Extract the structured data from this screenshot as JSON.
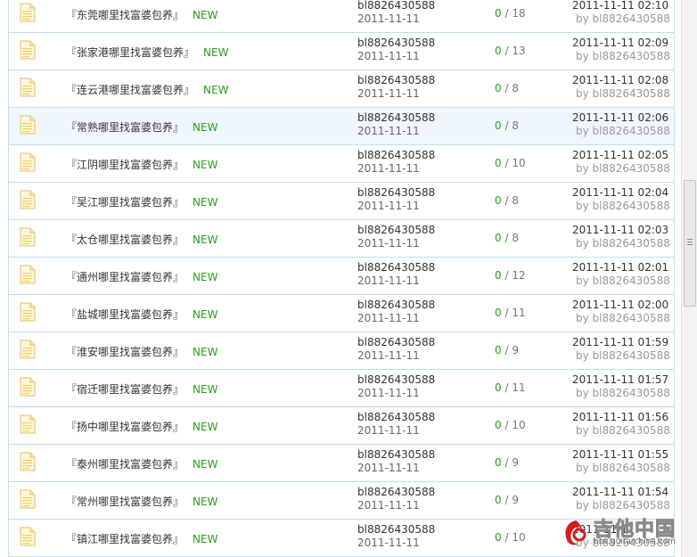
{
  "threads": [
    {
      "title": "『东莞哪里找富婆包养』",
      "badge": "NEW",
      "author": "bl8826430588",
      "post_date": "2011-11-11",
      "replies": "0",
      "views": "18",
      "last_time": "2011-11-11 02:10",
      "last_by": "by bl8826430588"
    },
    {
      "title": "『张家港哪里找富婆包养』",
      "badge": "NEW",
      "author": "bl8826430588",
      "post_date": "2011-11-11",
      "replies": "0",
      "views": "13",
      "last_time": "2011-11-11 02:09",
      "last_by": "by bl8826430588"
    },
    {
      "title": "『连云港哪里找富婆包养』",
      "badge": "NEW",
      "author": "bl8826430588",
      "post_date": "2011-11-11",
      "replies": "0",
      "views": "8",
      "last_time": "2011-11-11 02:08",
      "last_by": "by bl8826430588"
    },
    {
      "title": "『常熟哪里找富婆包养』",
      "badge": "NEW",
      "author": "bl8826430588",
      "post_date": "2011-11-11",
      "replies": "0",
      "views": "8",
      "last_time": "2011-11-11 02:06",
      "last_by": "by bl8826430588"
    },
    {
      "title": "『江阴哪里找富婆包养』",
      "badge": "NEW",
      "author": "bl8826430588",
      "post_date": "2011-11-11",
      "replies": "0",
      "views": "10",
      "last_time": "2011-11-11 02:05",
      "last_by": "by bl8826430588"
    },
    {
      "title": "『吴江哪里找富婆包养』",
      "badge": "NEW",
      "author": "bl8826430588",
      "post_date": "2011-11-11",
      "replies": "0",
      "views": "8",
      "last_time": "2011-11-11 02:04",
      "last_by": "by bl8826430588"
    },
    {
      "title": "『太仓哪里找富婆包养』",
      "badge": "NEW",
      "author": "bl8826430588",
      "post_date": "2011-11-11",
      "replies": "0",
      "views": "8",
      "last_time": "2011-11-11 02:03",
      "last_by": "by bl8826430588"
    },
    {
      "title": "『通州哪里找富婆包养』",
      "badge": "NEW",
      "author": "bl8826430588",
      "post_date": "2011-11-11",
      "replies": "0",
      "views": "12",
      "last_time": "2011-11-11 02:01",
      "last_by": "by bl8826430588"
    },
    {
      "title": "『盐城哪里找富婆包养』",
      "badge": "NEW",
      "author": "bl8826430588",
      "post_date": "2011-11-11",
      "replies": "0",
      "views": "11",
      "last_time": "2011-11-11 02:00",
      "last_by": "by bl8826430588"
    },
    {
      "title": "『淮安哪里找富婆包养』",
      "badge": "NEW",
      "author": "bl8826430588",
      "post_date": "2011-11-11",
      "replies": "0",
      "views": "9",
      "last_time": "2011-11-11 01:59",
      "last_by": "by bl8826430588"
    },
    {
      "title": "『宿迁哪里找富婆包养』",
      "badge": "NEW",
      "author": "bl8826430588",
      "post_date": "2011-11-11",
      "replies": "0",
      "views": "11",
      "last_time": "2011-11-11 01:57",
      "last_by": "by bl8826430588"
    },
    {
      "title": "『扬中哪里找富婆包养』",
      "badge": "NEW",
      "author": "bl8826430588",
      "post_date": "2011-11-11",
      "replies": "0",
      "views": "10",
      "last_time": "2011-11-11 01:56",
      "last_by": "by bl8826430588"
    },
    {
      "title": "『泰州哪里找富婆包养』",
      "badge": "NEW",
      "author": "bl8826430588",
      "post_date": "2011-11-11",
      "replies": "0",
      "views": "9",
      "last_time": "2011-11-11 01:55",
      "last_by": "by bl8826430588"
    },
    {
      "title": "『常州哪里找富婆包养』",
      "badge": "NEW",
      "author": "bl8826430588",
      "post_date": "2011-11-11",
      "replies": "0",
      "views": "9",
      "last_time": "2011-11-11 01:54",
      "last_by": "by bl8826430588"
    },
    {
      "title": "『镇江哪里找富婆包养』",
      "badge": "NEW",
      "author": "bl8826430588",
      "post_date": "2011-11-11",
      "replies": "0",
      "views": "10",
      "last_time": "2011-11-11",
      "last_by": "by bl8826430588"
    }
  ],
  "hover_row_index": 3,
  "icons": {
    "thread": "document-icon",
    "watermark": "guitar-china-logo"
  },
  "colors": {
    "border": "#c7dbe8",
    "new_badge": "#2a9d1f",
    "hover_bg": "#f0f7fc"
  },
  "watermark": {
    "name": "吉他中国",
    "url": "bbs.guitarchina.com"
  }
}
